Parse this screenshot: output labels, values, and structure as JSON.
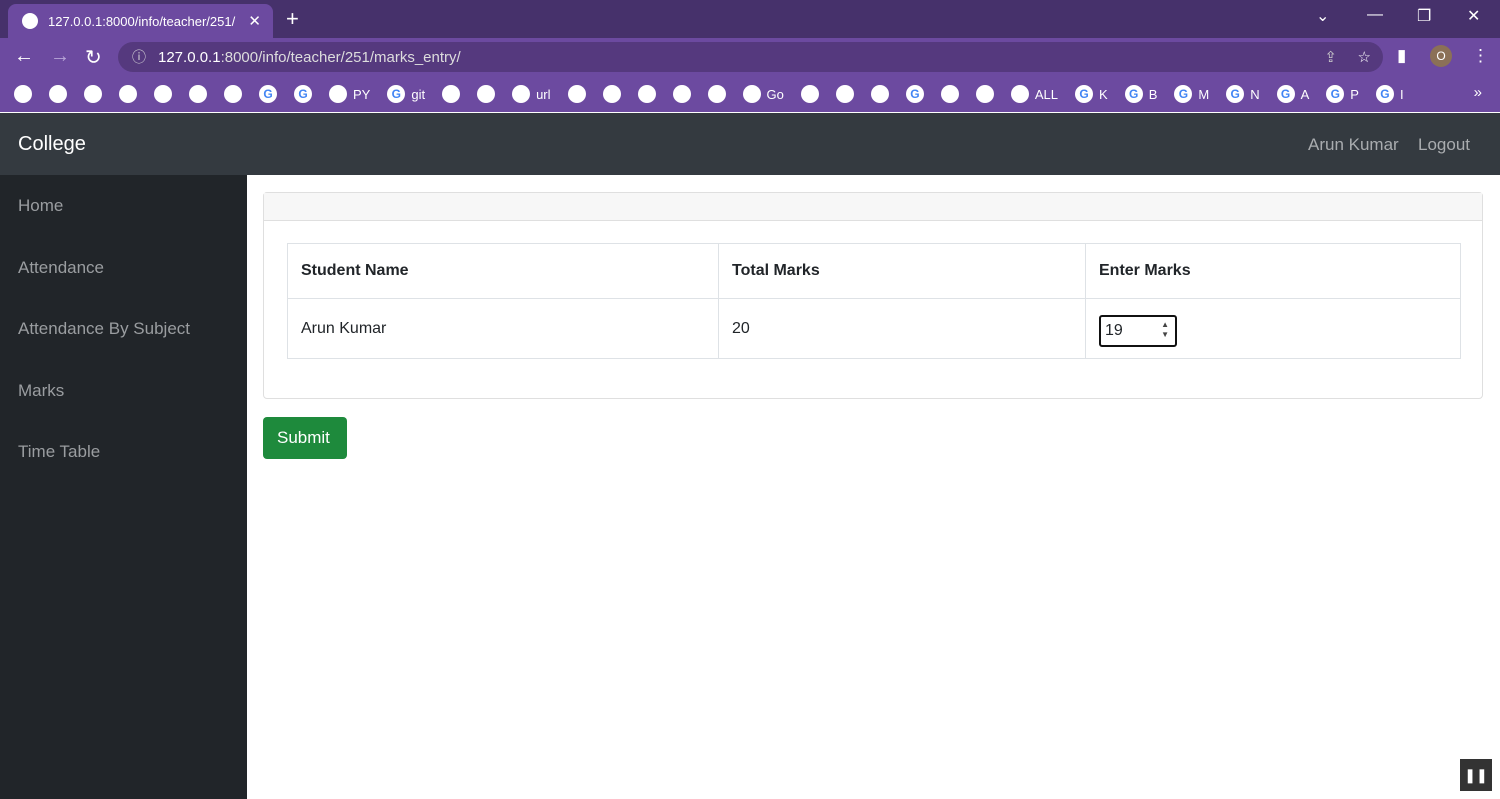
{
  "browser": {
    "tab_title": "127.0.0.1:8000/info/teacher/251/",
    "url_host": "127.0.0.1",
    "url_rest": ":8000/info/teacher/251/marks_entry/",
    "profile_initial": "O",
    "bookmarks": [
      {
        "icon": "drive-icon",
        "label": ""
      },
      {
        "icon": "plus-icon",
        "label": ""
      },
      {
        "icon": "app-icon",
        "label": ""
      },
      {
        "icon": "analytics-icon",
        "label": ""
      },
      {
        "icon": "ieee-icon",
        "label": ""
      },
      {
        "icon": "whatsapp-icon",
        "label": ""
      },
      {
        "icon": "telegram-icon",
        "label": ""
      },
      {
        "icon": "google-icon",
        "label": ""
      },
      {
        "icon": "google-icon",
        "label": ""
      },
      {
        "icon": "github-icon",
        "label": "PY"
      },
      {
        "icon": "google-icon",
        "label": "git"
      },
      {
        "icon": "page-icon",
        "label": ""
      },
      {
        "icon": "store-icon",
        "label": ""
      },
      {
        "icon": "link-icon",
        "label": "url"
      },
      {
        "icon": "youtube-icon",
        "label": ""
      },
      {
        "icon": "p-icon",
        "label": ""
      },
      {
        "icon": "camera-icon",
        "label": ""
      },
      {
        "icon": "cart-icon",
        "label": ""
      },
      {
        "icon": "circle-icon",
        "label": ""
      },
      {
        "icon": "go-icon",
        "label": "Go"
      },
      {
        "icon": "duck-icon",
        "label": ""
      },
      {
        "icon": "cl-icon",
        "label": ""
      },
      {
        "icon": "yandex-icon",
        "label": ""
      },
      {
        "icon": "google-icon",
        "label": ""
      },
      {
        "icon": "flame-icon",
        "label": ""
      },
      {
        "icon": "eye-icon",
        "label": ""
      },
      {
        "icon": "globe-icon",
        "label": "ALL"
      },
      {
        "icon": "google-icon",
        "label": "K"
      },
      {
        "icon": "google-icon",
        "label": "B"
      },
      {
        "icon": "google-icon",
        "label": "M"
      },
      {
        "icon": "google-icon",
        "label": "N"
      },
      {
        "icon": "google-icon",
        "label": "A"
      },
      {
        "icon": "google-icon",
        "label": "P"
      },
      {
        "icon": "google-icon",
        "label": "I"
      }
    ]
  },
  "app": {
    "brand": "College",
    "user": "Arun Kumar",
    "logout": "Logout",
    "sidebar": [
      "Home",
      "Attendance",
      "Attendance By Subject",
      "Marks",
      "Time Table"
    ],
    "table": {
      "headers": [
        "Student Name",
        "Total Marks",
        "Enter Marks"
      ],
      "rows": [
        {
          "name": "Arun Kumar",
          "total": "20",
          "entered": "19"
        }
      ]
    },
    "submit": "Submit"
  }
}
